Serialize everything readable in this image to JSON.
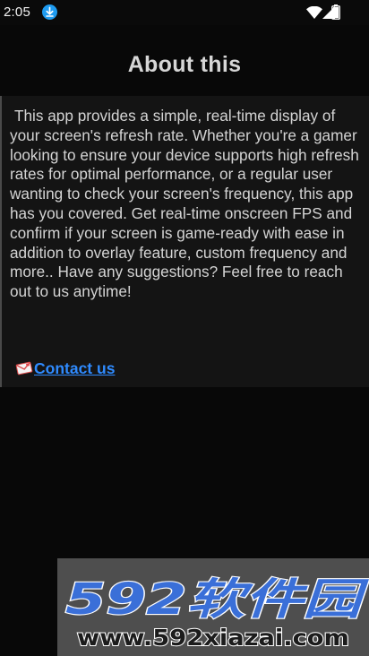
{
  "status_bar": {
    "time": "2:05",
    "icons": [
      "download-icon",
      "wifi-icon",
      "signal-icon",
      "battery-icon"
    ]
  },
  "page": {
    "title": "About this",
    "description": "This app provides a simple, real-time display of your screen's refresh rate. Whether you're a gamer looking to ensure your device supports high refresh rates for optimal performance, or a regular user wanting to check your screen's frequency, this app has you covered. Get real-time onscreen FPS and confirm if your screen is game-ready with ease in addition to overlay feature, custom frequency and more.. Have any suggestions? Feel free to reach out to us anytime!",
    "contact_label": "Contact us",
    "contact_icon": "mail-icon"
  },
  "watermark": {
    "brand": "592软件园",
    "url": "www.592xiazai.com"
  },
  "colors": {
    "background": "#080808",
    "card": "#141414",
    "title": "#d6d6d6",
    "text": "#d4d4d4",
    "link": "#2f8bff",
    "download_badge": "#1e9bf0",
    "watermark_bg": "#4e4e4e",
    "watermark_brand": "#3a6fd8"
  }
}
